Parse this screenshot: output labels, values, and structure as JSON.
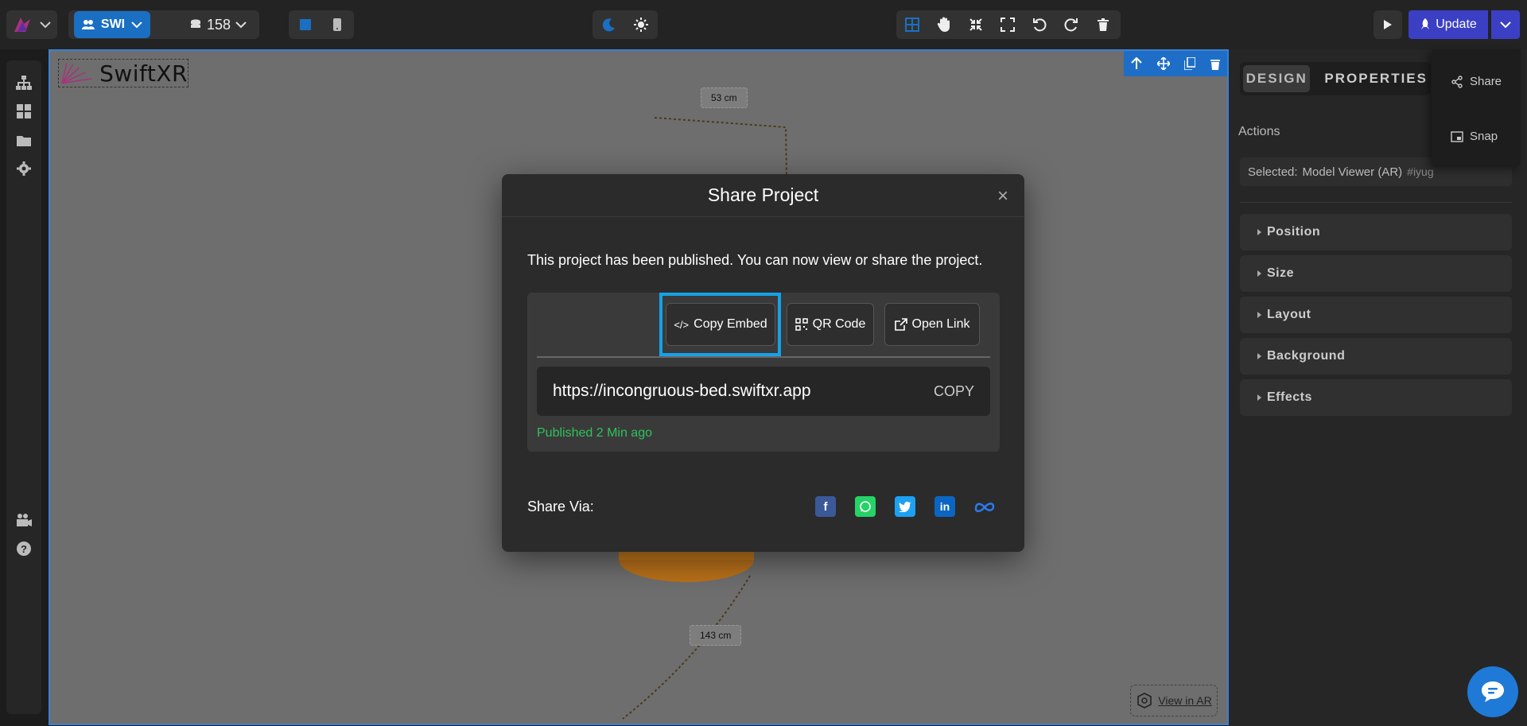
{
  "topbar": {
    "workspace_label": "SWI",
    "credits_value": "158",
    "update_label": "Update"
  },
  "canvas": {
    "logo_text": "SwiftXR",
    "dim_top": "53 cm",
    "dim_bottom": "143 cm",
    "view_ar_label": "View in AR"
  },
  "modal": {
    "title": "Share Project",
    "close_glyph": "×",
    "message": "This project has been published. You can now view or share the project.",
    "buttons": {
      "copy_embed": "Copy Embed",
      "qr_code": "QR Code",
      "open_link": "Open Link"
    },
    "url": "https://incongruous-bed.swiftxr.app",
    "copy_label": "COPY",
    "published_text": "Published 2 Min ago",
    "share_via_label": "Share Via:",
    "social": [
      {
        "name": "facebook",
        "color": "#3b5998",
        "glyph": "f"
      },
      {
        "name": "whatsapp",
        "color": "#25d366",
        "glyph": "w"
      },
      {
        "name": "twitter",
        "color": "#1da1f2",
        "glyph": "t"
      },
      {
        "name": "linkedin",
        "color": "#0a66c2",
        "glyph": "in"
      },
      {
        "name": "meta",
        "color": "#2a7bf0",
        "glyph": "∞"
      }
    ]
  },
  "right_panel": {
    "tabs": [
      "DESIGN",
      "PROPERTIES"
    ],
    "actions_label": "Actions",
    "selected_prefix": "Selected:",
    "selected_value": "Model Viewer (AR)",
    "selected_id": "#iyug",
    "sections": [
      "Position",
      "Size",
      "Layout",
      "Background",
      "Effects"
    ]
  },
  "dropdown": {
    "share_label": "Share",
    "snap_label": "Snap"
  },
  "colors": {
    "accent": "#1a6fc2",
    "highlight": "#14a2e8",
    "update": "#3b3fc4",
    "published": "#2fc25b"
  }
}
